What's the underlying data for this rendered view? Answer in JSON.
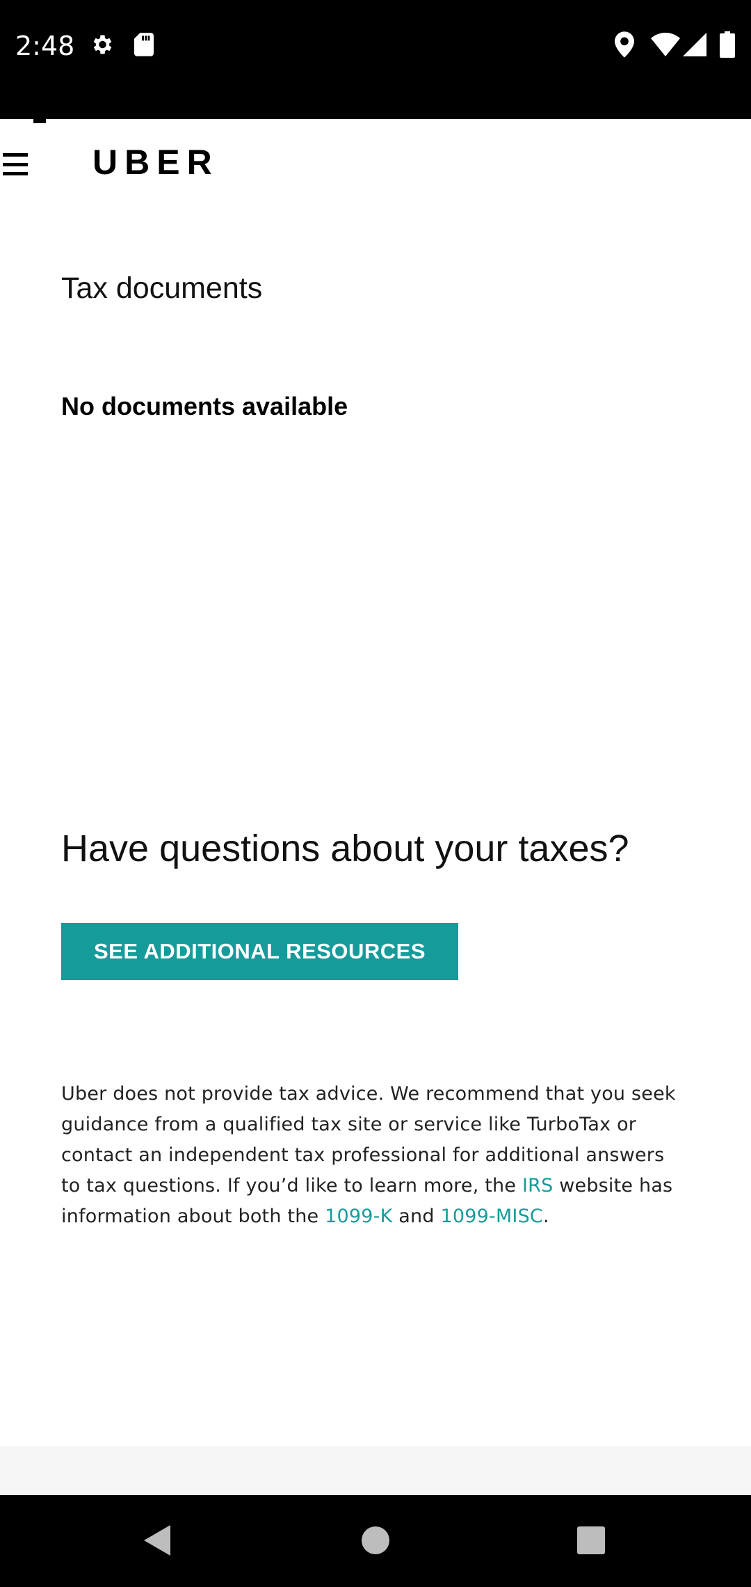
{
  "status_bar": {
    "time": "2:48",
    "icons": [
      "settings-icon",
      "sd-card-icon",
      "location-icon",
      "wifi-icon",
      "signal-icon",
      "battery-icon"
    ]
  },
  "header": {
    "brand": "UBER"
  },
  "main": {
    "title": "Tax documents",
    "empty_message": "No documents available",
    "questions_heading": "Have questions about your taxes?",
    "resources_button": "SEE ADDITIONAL RESOURCES",
    "disclaimer": {
      "text_before_irs": "Uber does not provide tax advice. We recommend that you seek guidance from a qualified tax site or service like TurboTax or contact an independent tax professional for additional answers to tax questions. If you’d like to learn more, the ",
      "irs_link": "IRS",
      "text_after_irs": " website has information about both the ",
      "link_1099k": "1099-K",
      "text_and": " and ",
      "link_1099misc": "1099-MISC",
      "text_end": "."
    }
  },
  "colors": {
    "accent": "#169b9b",
    "status_bar": "#000000",
    "nav_bar": "#000000"
  }
}
